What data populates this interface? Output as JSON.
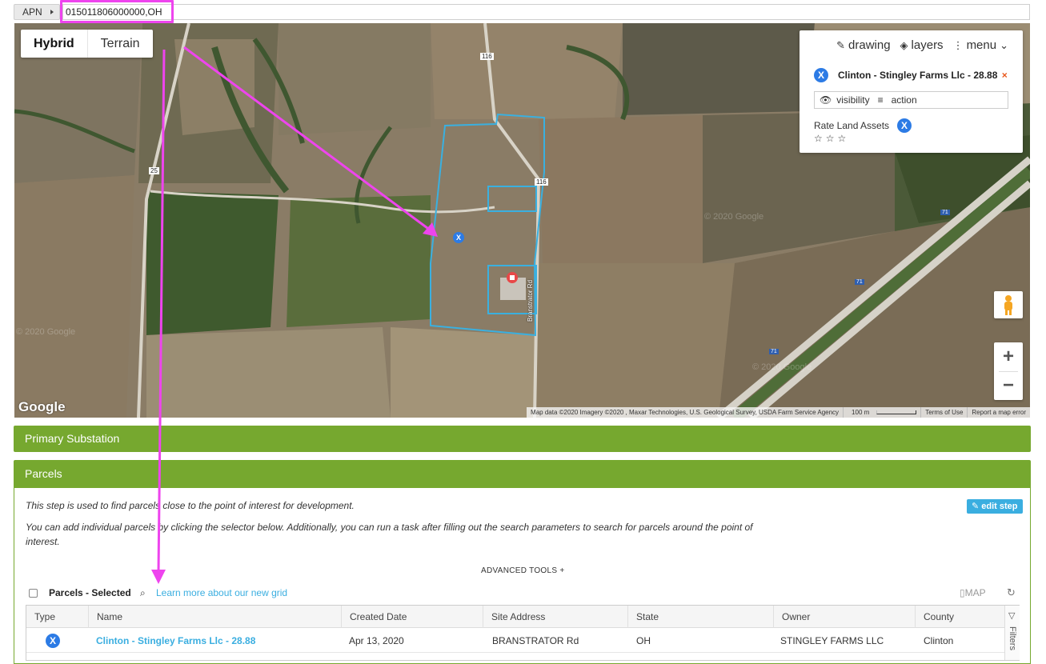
{
  "apn": {
    "button_label": "APN",
    "input_value": "015011806000000,OH"
  },
  "map": {
    "type_buttons": [
      "Hybrid",
      "Terrain"
    ],
    "active_type": "Hybrid",
    "road_labels": [
      "116",
      "25",
      "116",
      "71",
      "71",
      "71",
      "Branstrator Rd"
    ],
    "watermarks": [
      "© 2020 Google",
      "© 2020 Google",
      "© 2020 Google"
    ],
    "panel": {
      "drawing": "drawing",
      "layers": "layers",
      "menu": "menu",
      "parcel_name": "Clinton - Stingley Farms Llc - 28.88",
      "close": "×",
      "visibility": "visibility",
      "action": "action",
      "rate_label": "Rate Land Assets",
      "stars": "☆☆☆"
    },
    "marker_label": "X",
    "google_logo": "Google",
    "attribution": {
      "data": "Map data ©2020 Imagery ©2020 , Maxar Technologies, U.S. Geological Survey, USDA Farm Service Agency",
      "scale": "100 m",
      "terms": "Terms of Use",
      "report": "Report a map error"
    }
  },
  "sections": {
    "primary_substation": "Primary Substation",
    "parcels": "Parcels"
  },
  "parcels": {
    "desc1": "This step is used to find parcels close to the point of interest for development.",
    "desc2": "You can add individual parcels by clicking the selector below. Additionally, you can run a task after filling out the search parameters to search for parcels around the point of interest.",
    "edit_step": "edit step",
    "advanced_tools": "ADVANCED TOOLS +",
    "selected_label": "Parcels - Selected",
    "learn_more": "Learn more about our new grid",
    "map_button": "MAP",
    "filters": "Filters",
    "columns": [
      "Type",
      "Name",
      "Created Date",
      "Site Address",
      "State",
      "Owner",
      "County"
    ],
    "row": {
      "type": "X",
      "name": "Clinton - Stingley Farms Llc - 28.88",
      "created": "Apr 13, 2020",
      "address": "BRANSTRATOR Rd",
      "state": "OH",
      "owner": "STINGLEY FARMS LLC",
      "county": "Clinton"
    }
  },
  "colors": {
    "section_green": "#76a82f",
    "link_blue": "#3aaee0",
    "annotation_magenta": "#ee44ee",
    "parcel_outline": "#3ab0e0",
    "marker_blue": "#2c7be5"
  }
}
